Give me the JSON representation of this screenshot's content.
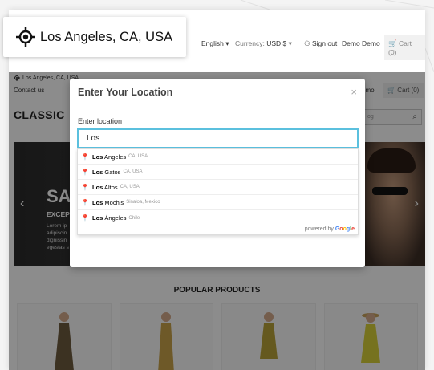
{
  "callout": {
    "location_text": "Los Angeles, CA, USA",
    "icon": "crosshair-location-icon"
  },
  "topbar": {
    "language": "English",
    "currency_prefix": "Currency:",
    "currency_value": "USD $",
    "signout": "Sign out",
    "user": "Demo Demo",
    "cart": "Cart (0)"
  },
  "page": {
    "mini_location": "Los Angeles, CA, USA",
    "contact": "Contact us",
    "user_partial": "emo",
    "cart": "Cart (0)",
    "logo": "CLASSIC",
    "search_placeholder_partial": "og",
    "banner_title_partial": "SA",
    "banner_subtitle_partial": "EXCEPT",
    "banner_text_partial": "Lorem ip adipiscin dignissin egestas s",
    "popular_title": "POPULAR PRODUCTS"
  },
  "modal": {
    "title": "Enter Your Location",
    "close": "×",
    "field_label": "Enter location",
    "input_value": "Los",
    "suggestions": [
      {
        "match": "Los",
        "rest": " Angeles",
        "secondary": "CA, USA"
      },
      {
        "match": "Los",
        "rest": " Gatos",
        "secondary": "CA, USA"
      },
      {
        "match": "Los",
        "rest": " Altos",
        "secondary": "CA, USA"
      },
      {
        "match": "Los",
        "rest": " Mochis",
        "secondary": "Sinaloa, Mexico"
      },
      {
        "match": "Los",
        "rest": " Ángeles",
        "secondary": "Chile"
      }
    ],
    "powered_by": "powered by",
    "google": [
      "G",
      "o",
      "o",
      "g",
      "l",
      "e"
    ]
  },
  "colors": {
    "input_border": "#5bc0de",
    "overlay": "rgba(0,0,0,0.45)"
  }
}
